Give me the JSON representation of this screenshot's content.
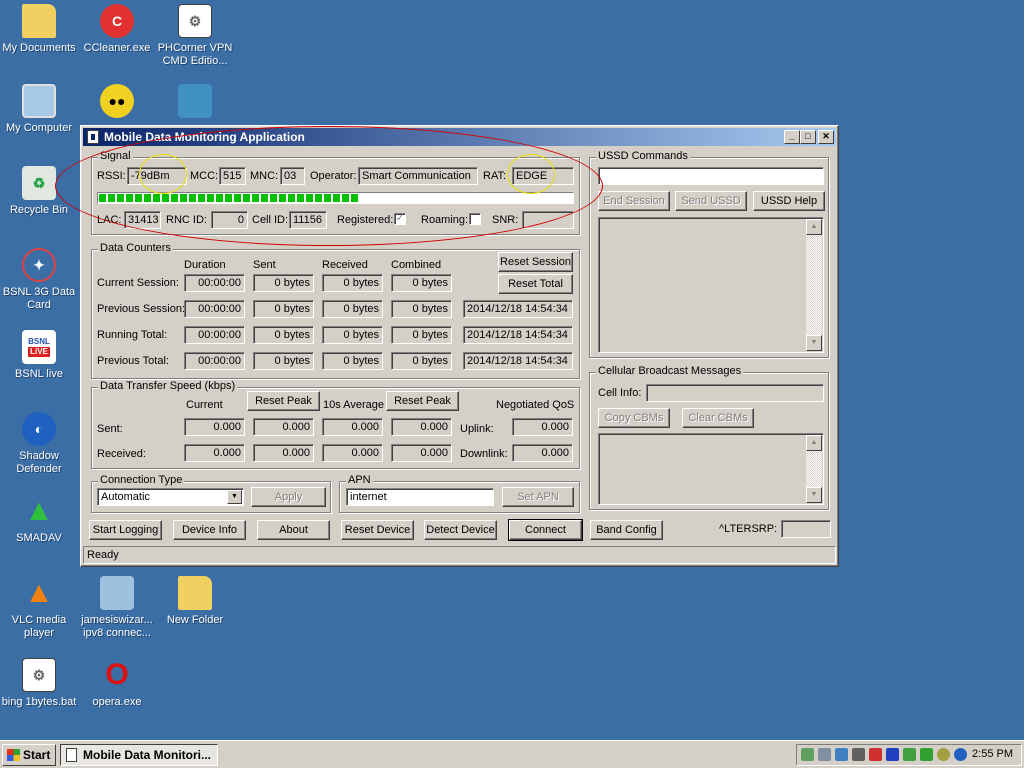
{
  "desktop": {
    "icons": [
      {
        "label": "My Documents"
      },
      {
        "label": "CCleaner.exe"
      },
      {
        "label": "PHCorner VPN CMD Editio..."
      },
      {
        "label": "My Computer"
      },
      {
        "label": "Recycle Bin"
      },
      {
        "label": "BSNL 3G Data Card"
      },
      {
        "label": "BSNL live",
        "badge_top": "BSNL",
        "badge_bottom": "LiVE"
      },
      {
        "label": "Shadow Defender"
      },
      {
        "label": "SMADAV"
      },
      {
        "label": "VLC media player"
      },
      {
        "label": "jamesiswizar... ipv8 connec..."
      },
      {
        "label": "New Folder"
      },
      {
        "label": "bing 1bytes.bat"
      },
      {
        "label": "opera.exe"
      }
    ]
  },
  "window": {
    "title": "Mobile Data Monitoring Application",
    "controls": {
      "minimize": "_",
      "maximize": "□",
      "close": "✕"
    },
    "signal": {
      "group_title": "Signal",
      "rssi_label": "RSSI:",
      "rssi": "-79dBm",
      "mcc_label": "MCC:",
      "mcc": "515",
      "mnc_label": "MNC:",
      "mnc": "03",
      "operator_label": "Operator:",
      "operator": "Smart Communication",
      "rat_label": "RAT:",
      "rat": "EDGE",
      "signal_strength": 0.55,
      "lac_label": "LAC:",
      "lac": "31413",
      "rnc_label": "RNC ID:",
      "rnc": "0",
      "cell_label": "Cell ID:",
      "cell": "11156",
      "registered_label": "Registered:",
      "registered_checked": true,
      "roaming_label": "Roaming:",
      "roaming_checked": false,
      "snr_label": "SNR:",
      "snr": ""
    },
    "counters": {
      "group_title": "Data Counters",
      "col_duration": "Duration",
      "col_sent": "Sent",
      "col_received": "Received",
      "col_combined": "Combined",
      "reset_session": "Reset Session",
      "reset_total": "Reset Total",
      "rows": [
        {
          "label": "Current Session:",
          "duration": "00:00:00",
          "sent": "0 bytes",
          "received": "0 bytes",
          "combined": "0 bytes",
          "timestamp": ""
        },
        {
          "label": "Previous Session:",
          "duration": "00:00:00",
          "sent": "0 bytes",
          "received": "0 bytes",
          "combined": "0 bytes",
          "timestamp": "2014/12/18 14:54:34"
        },
        {
          "label": "Running Total:",
          "duration": "00:00:00",
          "sent": "0 bytes",
          "received": "0 bytes",
          "combined": "0 bytes",
          "timestamp": "2014/12/18 14:54:34"
        },
        {
          "label": "Previous Total:",
          "duration": "00:00:00",
          "sent": "0 bytes",
          "received": "0 bytes",
          "combined": "0 bytes",
          "timestamp": "2014/12/18 14:54:34"
        }
      ]
    },
    "speed": {
      "group_title": "Data Transfer Speed (kbps)",
      "col_current": "Current",
      "reset_peak": "Reset Peak",
      "col_avg": "10s Average",
      "col_qos": "Negotiated QoS",
      "sent_label": "Sent:",
      "received_label": "Received:",
      "sent": [
        "0.000",
        "0.000",
        "0.000",
        "0.000"
      ],
      "received": [
        "0.000",
        "0.000",
        "0.000",
        "0.000"
      ],
      "uplink_label": "Uplink:",
      "uplink": "0.000",
      "downlink_label": "Downlink:",
      "downlink": "0.000"
    },
    "connection": {
      "group_title": "Connection Type",
      "value": "Automatic",
      "apply": "Apply"
    },
    "apn": {
      "group_title": "APN",
      "value": "internet",
      "set_apn": "Set APN"
    },
    "ussd": {
      "group_title": "USSD Commands",
      "input": "",
      "end_session": "End Session",
      "send_ussd": "Send USSD",
      "ussd_help": "USSD Help"
    },
    "cbm": {
      "group_title": "Cellular Broadcast Messages",
      "cell_info_label": "Cell Info:",
      "cell_info": "",
      "copy": "Copy CBMs",
      "clear": "Clear CBMs"
    },
    "buttons": {
      "start_logging": "Start Logging",
      "device_info": "Device Info",
      "about": "About",
      "reset_device": "Reset Device",
      "detect_device": "Detect Device",
      "connect": "Connect",
      "band_config": "Band Config"
    },
    "lte_label": "^LTERSRP:",
    "lte_value": "",
    "status": "Ready"
  },
  "taskbar": {
    "start": "Start",
    "task": "Mobile Data Monitori...",
    "clock": "2:55 PM"
  }
}
